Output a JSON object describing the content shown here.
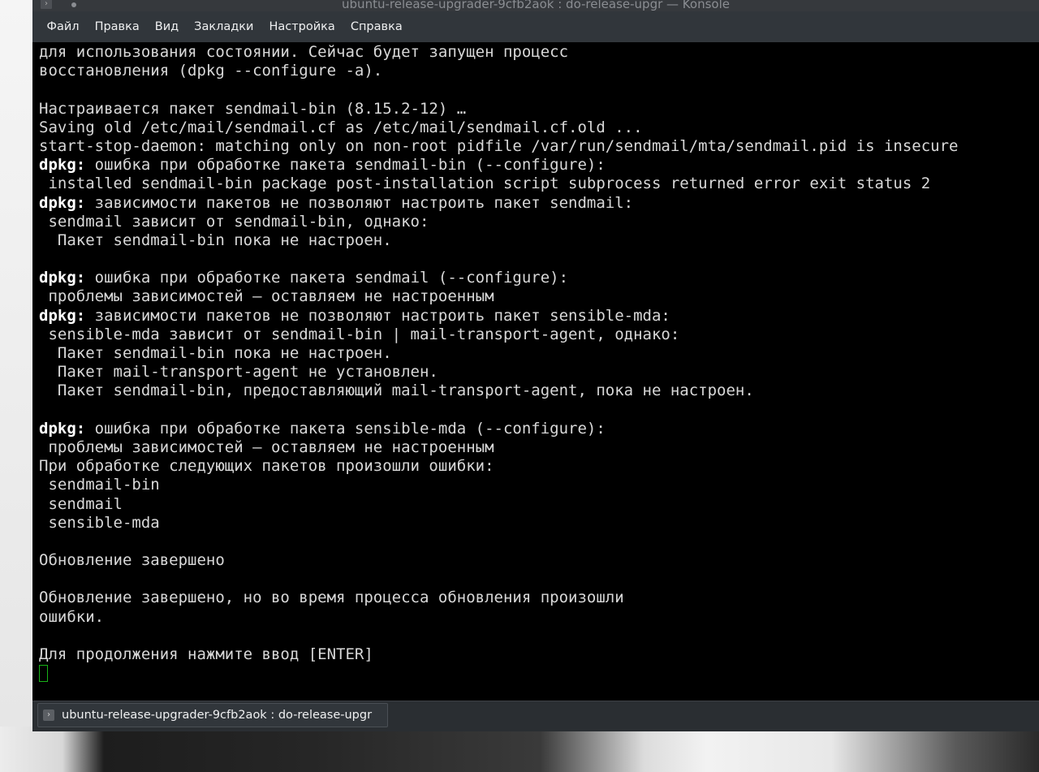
{
  "window": {
    "title": "ubuntu-release-upgrader-9cfb2aok : do-release-upgr — Konsole"
  },
  "menu": [
    "Файл",
    "Правка",
    "Вид",
    "Закладки",
    "Настройка",
    "Справка"
  ],
  "terminal": {
    "lines": [
      {
        "text": "для использования состоянии. Сейчас будет запущен процесс"
      },
      {
        "text": "восстановления (dpkg --configure -a)."
      },
      {
        "text": ""
      },
      {
        "text": "Настраивается пакет sendmail-bin (8.15.2-12) …"
      },
      {
        "text": "Saving old /etc/mail/sendmail.cf as /etc/mail/sendmail.cf.old ..."
      },
      {
        "text": "start-stop-daemon: matching only on non-root pidfile /var/run/sendmail/mta/sendmail.pid is insecure"
      },
      {
        "prefix": "dpkg:",
        "text": " ошибка при обработке пакета sendmail-bin (--configure):"
      },
      {
        "text": " installed sendmail-bin package post-installation script subprocess returned error exit status 2"
      },
      {
        "prefix": "dpkg:",
        "text": " зависимости пакетов не позволяют настроить пакет sendmail:"
      },
      {
        "text": " sendmail зависит от sendmail-bin, однако:"
      },
      {
        "text": "  Пакет sendmail-bin пока не настроен."
      },
      {
        "text": ""
      },
      {
        "prefix": "dpkg:",
        "text": " ошибка при обработке пакета sendmail (--configure):"
      },
      {
        "text": " проблемы зависимостей — оставляем не настроенным"
      },
      {
        "prefix": "dpkg:",
        "text": " зависимости пакетов не позволяют настроить пакет sensible-mda:"
      },
      {
        "text": " sensible-mda зависит от sendmail-bin | mail-transport-agent, однако:"
      },
      {
        "text": "  Пакет sendmail-bin пока не настроен."
      },
      {
        "text": "  Пакет mail-transport-agent не установлен."
      },
      {
        "text": "  Пакет sendmail-bin, предоставляющий mail-transport-agent, пока не настроен."
      },
      {
        "text": ""
      },
      {
        "prefix": "dpkg:",
        "text": " ошибка при обработке пакета sensible-mda (--configure):"
      },
      {
        "text": " проблемы зависимостей — оставляем не настроенным"
      },
      {
        "text": "При обработке следующих пакетов произошли ошибки:"
      },
      {
        "text": " sendmail-bin"
      },
      {
        "text": " sendmail"
      },
      {
        "text": " sensible-mda"
      },
      {
        "text": ""
      },
      {
        "text": "Обновление завершено"
      },
      {
        "text": ""
      },
      {
        "text": "Обновление завершено, но во время процесса обновления произошли"
      },
      {
        "text": "ошибки."
      },
      {
        "text": ""
      },
      {
        "text": "Для продолжения нажмите ввод [ENTER]"
      }
    ]
  },
  "tab": {
    "label": "ubuntu-release-upgrader-9cfb2aok : do-release-upgr"
  },
  "colors": {
    "terminal_bg": "#000000",
    "terminal_fg": "#d8d8d8",
    "cursor": "#18b218",
    "menubar_bg": "#31363b"
  },
  "icons": {
    "app": "terminal-icon",
    "tab": "terminal-icon"
  }
}
